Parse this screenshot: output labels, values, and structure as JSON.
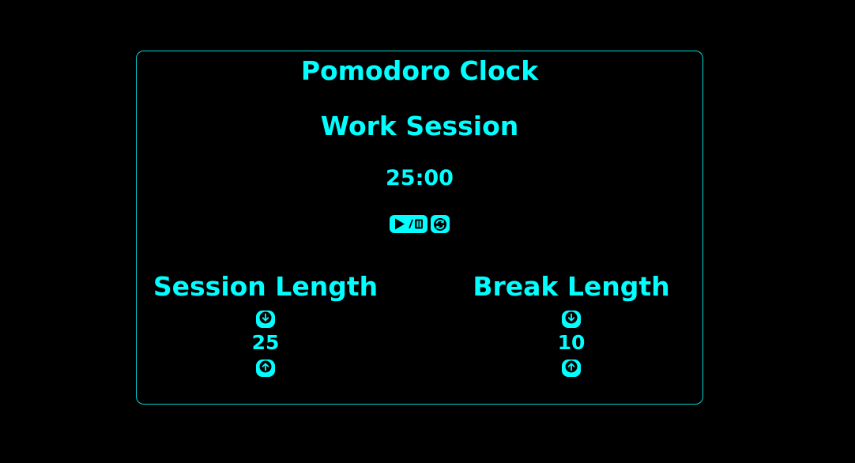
{
  "app": {
    "title": "Pomodoro Clock"
  },
  "timer": {
    "session_name": "Work Session",
    "display": "25:00"
  },
  "controls": {
    "play_pause_icon": "play-pause-icon",
    "reset_icon": "refresh-icon"
  },
  "session_length": {
    "label": "Session Length",
    "value": "25",
    "decrement_icon": "arrow-down-icon",
    "increment_icon": "arrow-up-icon"
  },
  "break_length": {
    "label": "Break Length",
    "value": "10",
    "decrement_icon": "arrow-down-icon",
    "increment_icon": "arrow-up-icon"
  },
  "colors": {
    "background": "#000000",
    "accent": "#00ffff",
    "border": "#00d8d8"
  }
}
